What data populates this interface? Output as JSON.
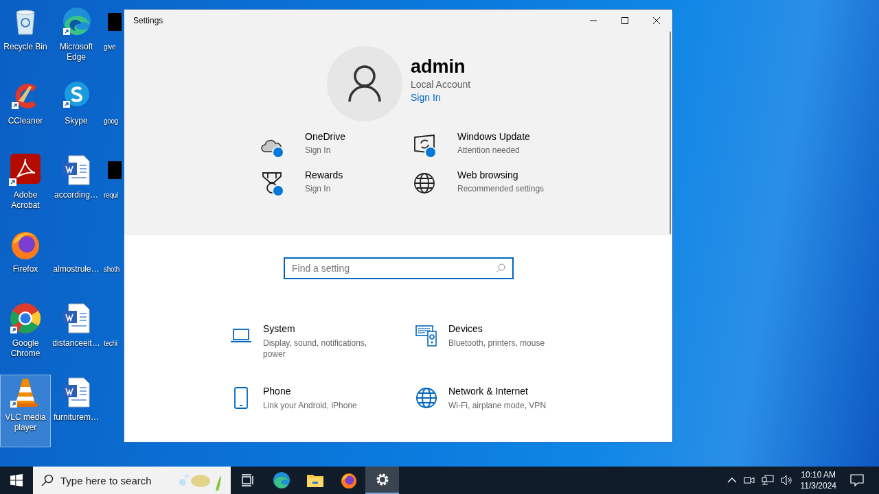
{
  "desktop": {
    "columns": [
      {
        "icons": [
          {
            "label": "Recycle Bin",
            "kind": "recycle-bin",
            "selected": false
          },
          {
            "label": "CCleaner",
            "kind": "ccleaner",
            "selected": false
          },
          {
            "label": "Adobe Acrobat",
            "kind": "acrobat",
            "selected": false
          },
          {
            "label": "Firefox",
            "kind": "firefox",
            "selected": false
          },
          {
            "label": "Google Chrome",
            "kind": "chrome",
            "selected": false
          },
          {
            "label": "VLC media player",
            "kind": "vlc",
            "selected": true
          }
        ]
      },
      {
        "icons": [
          {
            "label": "Microsoft Edge",
            "kind": "edge",
            "selected": false
          },
          {
            "label": "Skype",
            "kind": "skype",
            "selected": false
          },
          {
            "label": "according…",
            "kind": "word",
            "selected": false
          },
          {
            "label": "almostrule…",
            "kind": "blank",
            "selected": false
          },
          {
            "label": "distanceeit…",
            "kind": "word",
            "selected": false
          },
          {
            "label": "furniturem…",
            "kind": "word",
            "selected": false
          }
        ]
      },
      {
        "icons": [
          {
            "label": "give",
            "kind": "dark",
            "selected": false
          },
          {
            "label": "goog",
            "kind": "blank",
            "selected": false
          },
          {
            "label": "requi",
            "kind": "dark",
            "selected": false
          },
          {
            "label": "shoth",
            "kind": "blank",
            "selected": false
          },
          {
            "label": "techi",
            "kind": "blank",
            "selected": false
          }
        ]
      }
    ]
  },
  "window": {
    "title": "Settings"
  },
  "account": {
    "name": "admin",
    "type": "Local Account",
    "link": "Sign In"
  },
  "quick_links": [
    {
      "title": "OneDrive",
      "subtitle": "Sign In",
      "kind": "cloud",
      "badge": true
    },
    {
      "title": "Windows Update",
      "subtitle": "Attention needed",
      "kind": "update",
      "badge": true
    },
    {
      "title": "Rewards",
      "subtitle": "Sign In",
      "kind": "medal",
      "badge": true
    },
    {
      "title": "Web browsing",
      "subtitle": "Recommended settings",
      "kind": "globe",
      "badge": false
    }
  ],
  "search": {
    "placeholder": "Find a setting"
  },
  "categories": [
    {
      "title": "System",
      "description": "Display, sound, notifications, power",
      "kind": "laptop"
    },
    {
      "title": "Devices",
      "description": "Bluetooth, printers, mouse",
      "kind": "devices"
    },
    {
      "title": "Phone",
      "description": "Link your Android, iPhone",
      "kind": "phone"
    },
    {
      "title": "Network & Internet",
      "description": "Wi-Fi, airplane mode, VPN",
      "kind": "globe"
    }
  ],
  "taskbar": {
    "search_placeholder": "Type here to search",
    "apps": [
      {
        "kind": "task-view",
        "active": false
      },
      {
        "kind": "edge",
        "active": false
      },
      {
        "kind": "folder",
        "active": false
      },
      {
        "kind": "firefox",
        "active": false
      },
      {
        "kind": "gear",
        "active": true
      }
    ],
    "clock": {
      "time": "10:10 AM",
      "date": "11/3/2024"
    }
  }
}
